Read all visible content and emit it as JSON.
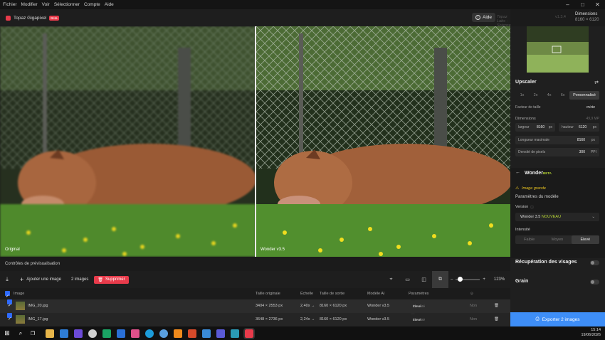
{
  "menu": [
    "Fichier",
    "Modifier",
    "Voir",
    "Sélectionner",
    "Compte",
    "Aide"
  ],
  "window_controls": {
    "minimize": "–",
    "maximize": "□",
    "close": "✕"
  },
  "app": {
    "name": "Topaz Gigapixel",
    "badge": "Beta",
    "help": "Aide",
    "subtitle": "Topaz Labs · Science Rationale",
    "version": "v1.3.4"
  },
  "dimensions_header": {
    "label": "Dimensions",
    "value": "8160 × 6120"
  },
  "preview": {
    "left_label": "Original",
    "right_label": "Wonder v3.5"
  },
  "controls_label": "Contrôles de prévisualisation",
  "toolbar": {
    "add_image": "Ajouter une image",
    "count": "2 images",
    "delete": "Supprimer",
    "zoom": "123%",
    "zoom_minus": "–",
    "zoom_plus": "+"
  },
  "table": {
    "headers": {
      "image": "Image",
      "original_size": "Taille originale",
      "scale": "Échelle",
      "output_size": "Taille de sortie",
      "model": "Modèle AI",
      "params": "Paramètres"
    },
    "rows": [
      {
        "name": "IMG_20.jpg",
        "original": "3404 × 2553 px",
        "scale": "2,40x",
        "output": "8160 × 6120 px",
        "model": "Wonder v3.5",
        "param_label": "Intensité",
        "param_value": "Élevé",
        "extra": "Non"
      },
      {
        "name": "IMG_17.jpg",
        "original": "3648 × 2736 px",
        "scale": "2,24x",
        "output": "8160 × 6120 px",
        "model": "Wonder v3.5",
        "param_label": "Intensité",
        "param_value": "Élevé",
        "extra": "Non"
      }
    ]
  },
  "upscaler": {
    "title": "Upscaler",
    "scales": [
      "1x",
      "2x",
      "4x",
      "6x",
      "Personnalisé"
    ],
    "factor_label": "Facteur de taille",
    "factor_value": "mixte",
    "dims_label": "Dimensions",
    "dims_mp": "49,9 MP",
    "width_label": "largeur",
    "width_value": "8160",
    "width_unit": "px",
    "height_label": "hauteur",
    "height_value": "6120",
    "height_unit": "px",
    "maxlen_label": "Longueur maximale",
    "maxlen_value": "8160",
    "maxlen_unit": "px",
    "density_label": "Densité de pixels",
    "density_value": "300",
    "density_unit": "PPI"
  },
  "wonder": {
    "title": "Wonder",
    "badge": "BETA",
    "warning": "Image grande",
    "params_label": "Paramètres du modèle",
    "version_label": "Version",
    "version_value": "Wonder 3.5",
    "version_new": "NOUVEAU",
    "intensity_label": "Intensité",
    "intensity_options": [
      "Faible",
      "Moyen",
      "Élevé"
    ]
  },
  "faces_label": "Récupération des visages",
  "grain_label": "Grain",
  "export_label": "Exporter 2 images",
  "tray": {
    "time": "15:14",
    "date": "19/06/2026"
  }
}
